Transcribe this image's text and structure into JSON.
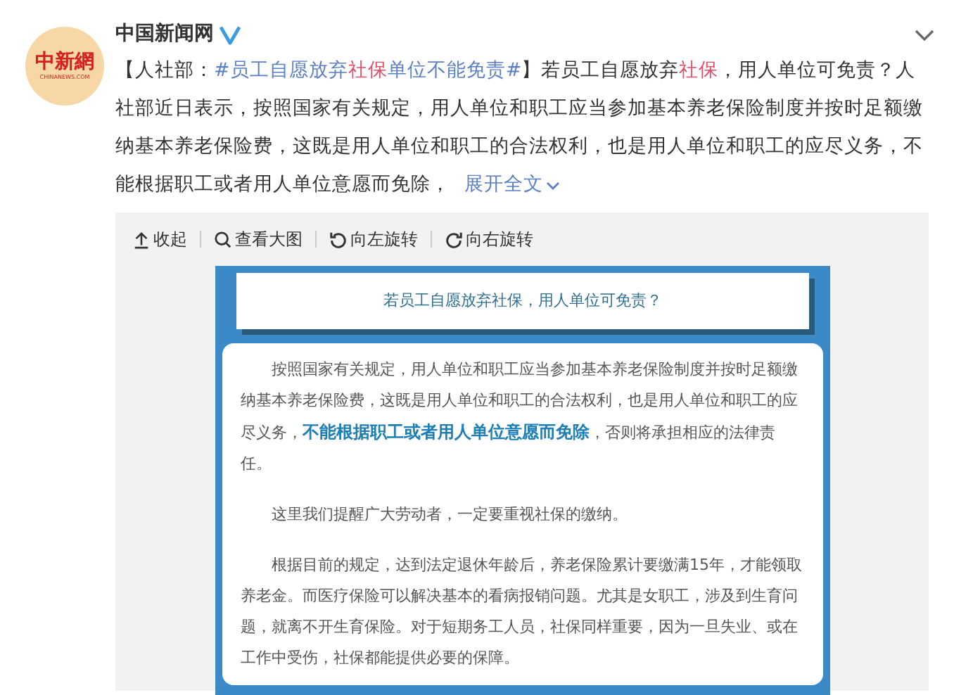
{
  "avatar": {
    "logo": "中新網",
    "sub": "CHINANEWS.COM"
  },
  "author": {
    "name": "中国新闻网",
    "verified": true
  },
  "post": {
    "segments": [
      {
        "kind": "text",
        "text": "【人社部："
      },
      {
        "kind": "link",
        "parts": [
          {
            "text": "#员工自愿放弃",
            "keyword": false
          },
          {
            "text": "社保",
            "keyword": true
          },
          {
            "text": "单位不能免责#",
            "keyword": false
          }
        ]
      },
      {
        "kind": "text",
        "text": "】若员工自愿放弃"
      },
      {
        "kind": "keyword",
        "text": "社保"
      },
      {
        "kind": "text",
        "text": "，用人单位可免责？人社部近日表示，按照国家有关规定，用人单位和职工应当参加基本养老保险制度并按时足额缴纳基本养老保险费，这既是用人单位和职工的合法权利，也是用人单位和职工的应尽义务，不能根据职工或者用人单位意愿而免除，"
      }
    ],
    "expand": "展开全文"
  },
  "toolbar": [
    {
      "kind": "collapse",
      "label": "收起"
    },
    {
      "kind": "zoom",
      "label": "查看大图"
    },
    {
      "kind": "rotate_left",
      "label": "向左旋转"
    },
    {
      "kind": "rotate_right",
      "label": "向右旋转"
    }
  ],
  "graphic": {
    "title": "若员工自愿放弃社保，用人单位可免责？",
    "paragraphs": [
      "按照国家有关规定，用人单位和职工应当参加基本养老保险制度并按时足额缴纳基本养老保险费，这既是用人单位和职工的合法权利，也是用人单位和职工的应尽义务，**不能根据职工或者用人单位意愿而免除**，否则将承担相应的法律责任。",
      "这里我们提醒广大劳动者，一定要重视社保的缴纳。",
      "根据目前的规定，达到法定退休年龄后，养老保险累计要缴满15年，才能领取养老金。而医疗保险可以解决基本的看病报销问题。尤其是女职工，涉及到生育问题，就离不开生育保险。对于短期务工人员，社保同样重要，因为一旦失业、或在工作中受伤，社保都能提供必要的保障。"
    ]
  }
}
